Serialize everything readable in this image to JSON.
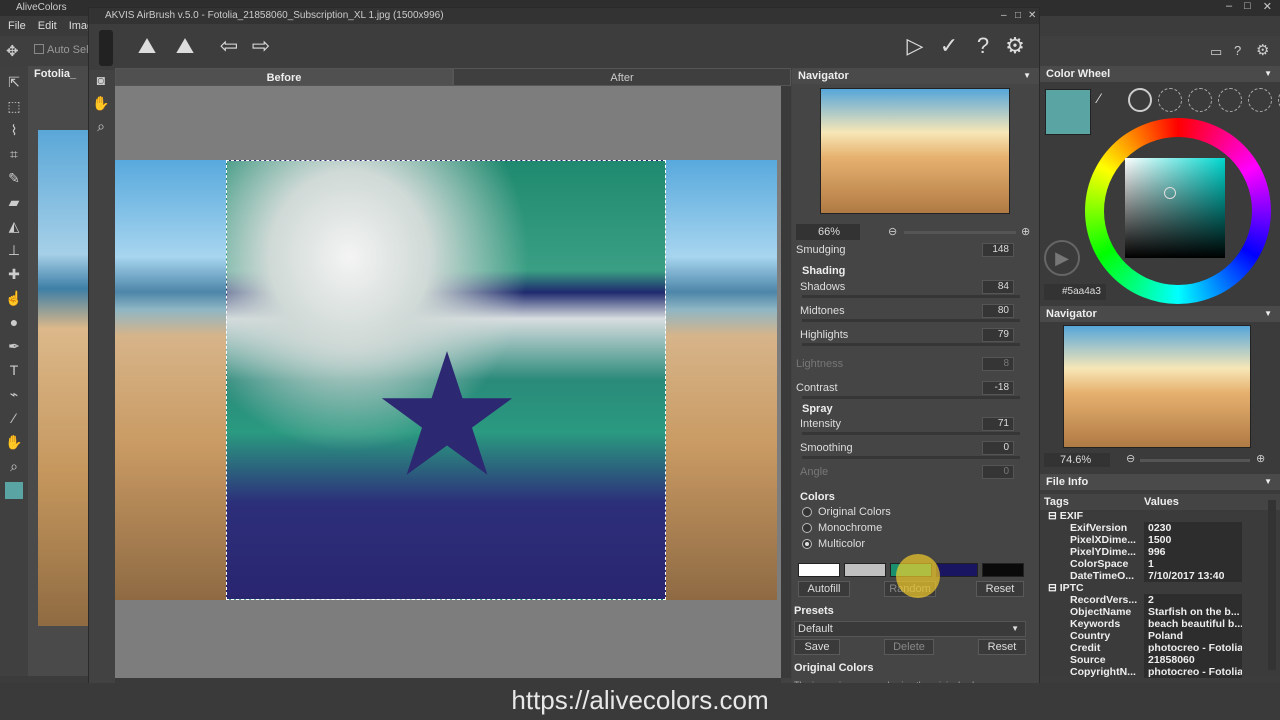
{
  "host": {
    "title": "AliveColors",
    "menu": [
      "File",
      "Edit",
      "Image"
    ],
    "auto_select": "Auto Sele",
    "doc_tab": "Fotolia_",
    "color_wheel_title": "Color Wheel",
    "color_hex": "#5aa4a3",
    "navigator_title": "Navigator",
    "navigator_zoom": "74.6%",
    "file_info_title": "File Info",
    "file_info_headers": [
      "Tags",
      "Values"
    ],
    "file_info_rows": [
      {
        "key": "EXIF",
        "value": "",
        "group": true
      },
      {
        "key": "ExifVersion",
        "value": "0230"
      },
      {
        "key": "PixelXDime...",
        "value": "1500"
      },
      {
        "key": "PixelYDime...",
        "value": "996"
      },
      {
        "key": "ColorSpace",
        "value": "1"
      },
      {
        "key": "DateTimeO...",
        "value": "7/10/2017 13:40"
      },
      {
        "key": "IPTC",
        "value": "",
        "group": true
      },
      {
        "key": "RecordVers...",
        "value": "2"
      },
      {
        "key": "ObjectName",
        "value": "Starfish on the b..."
      },
      {
        "key": "Keywords",
        "value": "beach beautiful b..."
      },
      {
        "key": "Country",
        "value": "Poland"
      },
      {
        "key": "Credit",
        "value": "photocreo - Fotolia"
      },
      {
        "key": "Source",
        "value": "21858060"
      },
      {
        "key": "CopyrightN...",
        "value": "photocreo - Fotolia"
      }
    ],
    "accent_color": "#5aa4a3"
  },
  "plugin": {
    "title": "AKVIS AirBrush v.5.0 - Fotolia_21858060_Subscription_XL 1.jpg (1500x996)",
    "tab_before": "Before",
    "tab_after": "After",
    "navigator_title": "Navigator",
    "zoom": "66%",
    "smudging_label": "Smudging",
    "smudging_value": "148",
    "shading_title": "Shading",
    "shadows_label": "Shadows",
    "shadows_value": "84",
    "midtones_label": "Midtones",
    "midtones_value": "80",
    "highlights_label": "Highlights",
    "highlights_value": "79",
    "lightness_label": "Lightness",
    "lightness_value": "8",
    "contrast_label": "Contrast",
    "contrast_value": "-18",
    "spray_title": "Spray",
    "intensity_label": "Intensity",
    "intensity_value": "71",
    "smoothing_label": "Smoothing",
    "smoothing_value": "0",
    "angle_label": "Angle",
    "angle_value": "0",
    "colors_title": "Colors",
    "color_modes": [
      "Original Colors",
      "Monochrome",
      "Multicolor"
    ],
    "selected_mode": "Multicolor",
    "swatches": [
      "#ffffff",
      "#c0c0c0",
      "#1a8f6e",
      "#1a1560",
      "#0a0a0a"
    ],
    "autofill_label": "Autofill",
    "random_label": "Random",
    "reset_colors_label": "Reset",
    "presets_title": "Presets",
    "preset_value": "Default",
    "save_label": "Save",
    "delete_label": "Delete",
    "reset_preset_label": "Reset",
    "original_colors_heading": "Original Colors",
    "original_colors_text": "The image is processed using the original color"
  },
  "footer": {
    "url": "https://alivecolors.com"
  }
}
